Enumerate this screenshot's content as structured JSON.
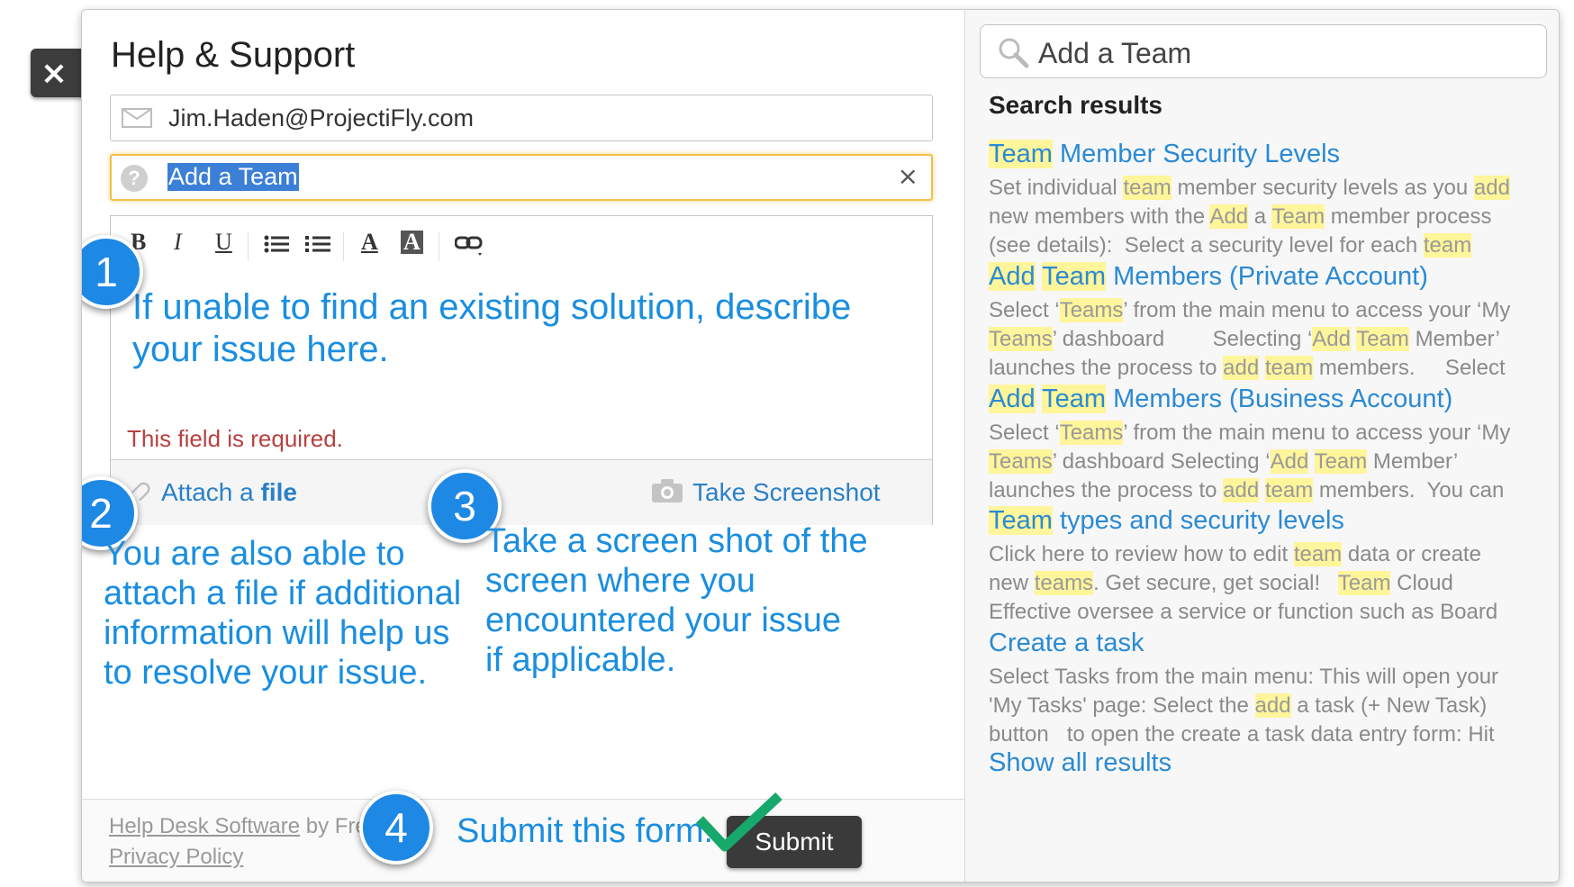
{
  "close_label": "×",
  "header": {
    "title": "Help & Support"
  },
  "form": {
    "email_value": "Jim.Haden@ProjectiFly.com",
    "subject_value": "Add a Team",
    "clear_label": "×",
    "toolbar": {
      "bold": "B",
      "italic": "I",
      "underline": "U",
      "font_color": "A",
      "bg_color": "A"
    },
    "description_placeholder": "If unable to find an existing solution, describe your issue here.",
    "required_message": "This field is required.",
    "attach_prefix": "Attach a",
    "attach_word": "file",
    "screenshot_label": "Take Screenshot"
  },
  "annotations": {
    "badge_1": "1",
    "badge_2": "2",
    "badge_3": "3",
    "badge_4": "4",
    "note_2": [
      "You are also able to",
      "attach a file if additional",
      "information will help us",
      "to resolve your issue."
    ],
    "note_3": [
      "Take a screen shot of the",
      "screen where you",
      "encountered your issue",
      "if applicable."
    ],
    "note_4": "Submit this form:"
  },
  "footer": {
    "line1_link": "Help Desk Software",
    "line1_rest": "by Fresho",
    "line2_link": "Privacy Policy",
    "submit_label": "Submit"
  },
  "search": {
    "value": "Add a Team",
    "results_heading": "Search results",
    "results": [
      {
        "title": "Team Member Security Levels",
        "snippet": [
          "Set individual team member security levels as you add",
          "new members with the Add a Team member process",
          "(see details):  Select a security level for each team"
        ]
      },
      {
        "title": "Add Team Members (Private Account)",
        "snippet": [
          "Select ‘Teams’ from the main menu to access your ‘My",
          "Teams’ dashboard        Selecting ‘Add Team Member’",
          "launches the process to add team members.     Select"
        ]
      },
      {
        "title": "Add Team Members (Business Account)",
        "snippet": [
          "Select ‘Teams’ from the main menu to access your ‘My",
          "Teams’ dashboard Selecting ‘Add Team Member’",
          "launches the process to add team members.  You can"
        ]
      },
      {
        "title": "Team types and security levels",
        "snippet": [
          "Click here to review how to edit team data or create",
          "new teams. Get secure, get social!   Team Cloud",
          "Effective oversee a service or function such as Board"
        ]
      },
      {
        "title": "Create a task",
        "snippet": [
          "Select Tasks from the main menu: This will open your",
          "'My Tasks' page: Select the add a task (+ New Task)",
          "button   to open the create a task data entry form: Hit"
        ]
      }
    ],
    "show_all": "Show all results"
  }
}
